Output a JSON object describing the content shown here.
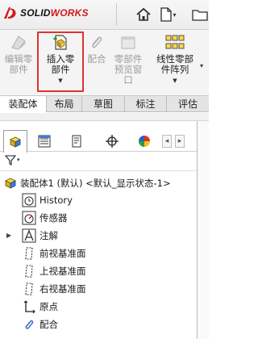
{
  "app": {
    "logo_ds": "DS",
    "logo_solid": "SOLID",
    "logo_works": "WORKS"
  },
  "ribbon": {
    "edit_part": "编辑零\n部件",
    "insert_part": "插入零\n部件",
    "mate": "配合",
    "preview_window": "零部件\n预览窗\n口",
    "linear_pattern": "线性零部\n件阵列"
  },
  "tabs": [
    "装配体",
    "布局",
    "草图",
    "标注",
    "评估"
  ],
  "active_tab": 0,
  "tree": {
    "root": "装配体1 (默认) <默认_显示状态-1>",
    "items": [
      "History",
      "传感器",
      "注解",
      "前视基准面",
      "上视基准面",
      "右视基准面",
      "原点",
      "配合"
    ]
  },
  "colors": {
    "accent_red": "#e0312d",
    "brand_red": "#d5161e",
    "tab_active_bg": "#ffffff"
  }
}
